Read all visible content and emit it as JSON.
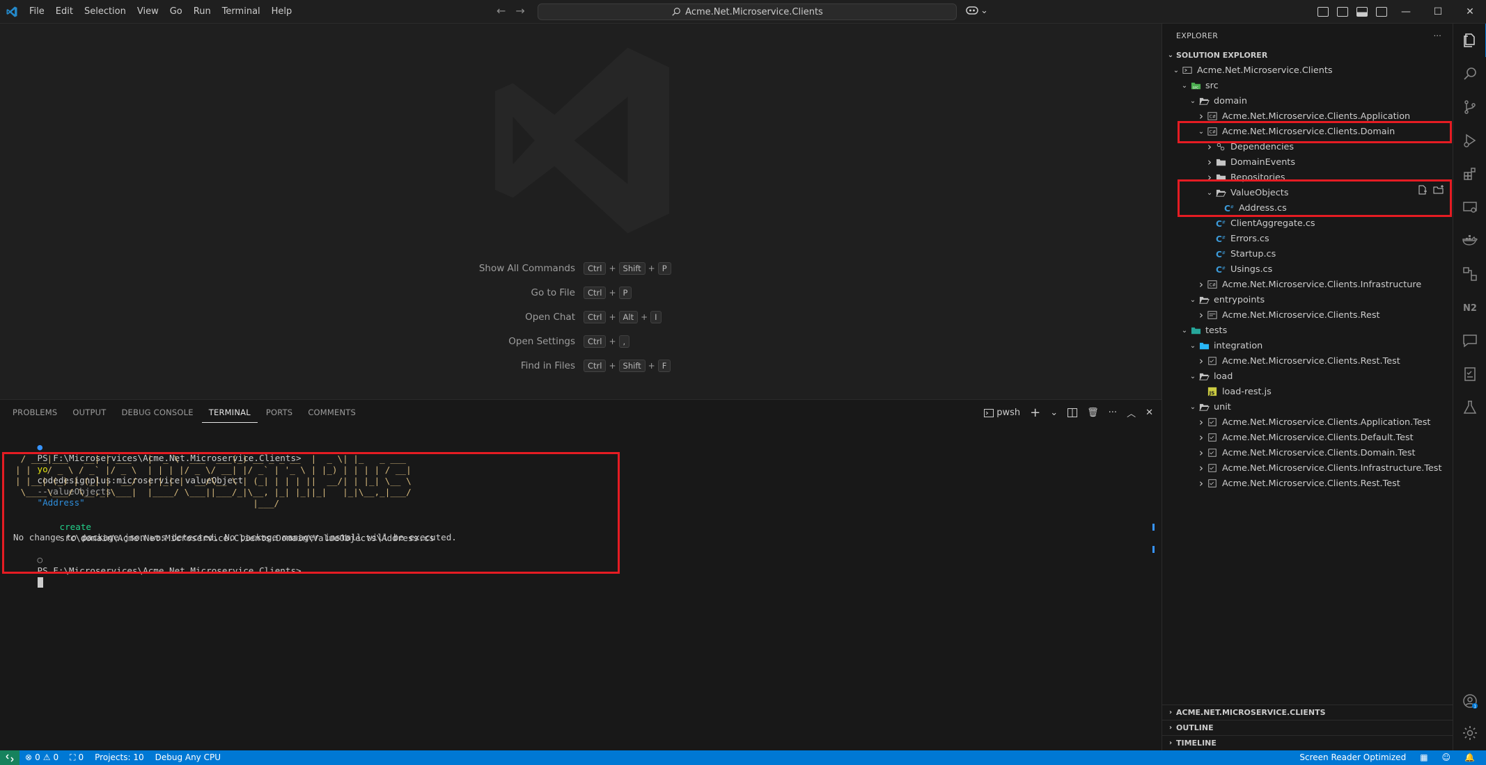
{
  "menu": [
    "File",
    "Edit",
    "Selection",
    "View",
    "Go",
    "Run",
    "Terminal",
    "Help"
  ],
  "title": {
    "search": "Acme.Net.Microservice.Clients",
    "back": "←",
    "forward": "→",
    "copilot_caret": "⌄"
  },
  "window": {
    "minimize": "—",
    "maximize": "☐",
    "close": "✕"
  },
  "shortcuts": [
    {
      "label": "Show All Commands",
      "keys": [
        "Ctrl",
        "Shift",
        "P"
      ]
    },
    {
      "label": "Go to File",
      "keys": [
        "Ctrl",
        "P"
      ]
    },
    {
      "label": "Open Chat",
      "keys": [
        "Ctrl",
        "Alt",
        "I"
      ]
    },
    {
      "label": "Open Settings",
      "keys": [
        "Ctrl",
        ","
      ]
    },
    {
      "label": "Find in Files",
      "keys": [
        "Ctrl",
        "Shift",
        "F"
      ]
    }
  ],
  "panel": {
    "tabs": [
      "PROBLEMS",
      "OUTPUT",
      "DEBUG CONSOLE",
      "TERMINAL",
      "PORTS",
      "COMMENTS"
    ],
    "active_tab": "TERMINAL",
    "shell": "pwsh"
  },
  "terminal": {
    "prompt": "PS F:\\Microservices\\Acme.Net.Microservice.Clients>",
    "cmd_yo": "yo",
    "cmd_rest": "codedesignplus:microservice valueObject",
    "cmd_flag": "--valueObjects",
    "cmd_arg": "\"Address\"",
    "ascii": [
      "  ____          _         ____            _              ____  _            ",
      " / ___|___   __| | ___   |  _ \\  ___  ___(_) __ _ _ __  |  _ \\| |_   _ ___ ",
      "| |   / _ \\ / _` |/ _ \\  | | | |/ _ \\/ __| |/ _` | '_ \\ | |_) | | | | / __|",
      "| |__| (_) | (_| |  __/  | |_| |  __/\\__ \\ | (_| | | | ||  __/| | |_| \\__ \\",
      " \\____\\___/ \\__,_|\\___|  |____/ \\___||___/_|\\__, |_| |_||_|   |_|\\__,_|___/",
      "                                             |___/                          "
    ],
    "create_word": "create",
    "create_path": "src\\domain\\Acme.Net.Microservice.Clients.Domain\\ValueObjects\\Address.cs",
    "notice": "No change to package.json was detected. No package manager install will be executed."
  },
  "explorer": {
    "header": "EXPLORER",
    "more": "···",
    "section": "SOLUTION EXPLORER",
    "tree": [
      {
        "label": "Acme.Net.Microservice.Clients",
        "depth": 0,
        "chevron": "open",
        "icon": "solution"
      },
      {
        "label": "src",
        "depth": 1,
        "chevron": "open",
        "icon": "folder-src"
      },
      {
        "label": "domain",
        "depth": 2,
        "chevron": "open",
        "icon": "folder-open"
      },
      {
        "label": "Acme.Net.Microservice.Clients.Application",
        "depth": 3,
        "chevron": "closed",
        "icon": "project"
      },
      {
        "label": "Acme.Net.Microservice.Clients.Domain",
        "depth": 3,
        "chevron": "open",
        "icon": "project"
      },
      {
        "label": "Dependencies",
        "depth": 4,
        "chevron": "closed",
        "icon": "dependencies"
      },
      {
        "label": "DomainEvents",
        "depth": 4,
        "chevron": "closed",
        "icon": "folder"
      },
      {
        "label": "Repositories",
        "depth": 4,
        "chevron": "closed",
        "icon": "folder"
      },
      {
        "label": "ValueObjects",
        "depth": 4,
        "chevron": "open",
        "icon": "folder-open"
      },
      {
        "label": "Address.cs",
        "depth": 5,
        "chevron": "none",
        "icon": "csharp"
      },
      {
        "label": "ClientAggregate.cs",
        "depth": 4,
        "chevron": "none",
        "icon": "csharp"
      },
      {
        "label": "Errors.cs",
        "depth": 4,
        "chevron": "none",
        "icon": "csharp"
      },
      {
        "label": "Startup.cs",
        "depth": 4,
        "chevron": "none",
        "icon": "csharp"
      },
      {
        "label": "Usings.cs",
        "depth": 4,
        "chevron": "none",
        "icon": "csharp"
      },
      {
        "label": "Acme.Net.Microservice.Clients.Infrastructure",
        "depth": 3,
        "chevron": "closed",
        "icon": "project"
      },
      {
        "label": "entrypoints",
        "depth": 2,
        "chevron": "open",
        "icon": "folder-open"
      },
      {
        "label": "Acme.Net.Microservice.Clients.Rest",
        "depth": 3,
        "chevron": "closed",
        "icon": "project-web"
      },
      {
        "label": "tests",
        "depth": 1,
        "chevron": "open",
        "icon": "folder-test"
      },
      {
        "label": "integration",
        "depth": 2,
        "chevron": "open",
        "icon": "folder-integration"
      },
      {
        "label": "Acme.Net.Microservice.Clients.Rest.Test",
        "depth": 3,
        "chevron": "closed",
        "icon": "project-test"
      },
      {
        "label": "load",
        "depth": 2,
        "chevron": "open",
        "icon": "folder-open"
      },
      {
        "label": "load-rest.js",
        "depth": 3,
        "chevron": "none",
        "icon": "js"
      },
      {
        "label": "unit",
        "depth": 2,
        "chevron": "open",
        "icon": "folder-open"
      },
      {
        "label": "Acme.Net.Microservice.Clients.Application.Test",
        "depth": 3,
        "chevron": "closed",
        "icon": "project-test"
      },
      {
        "label": "Acme.Net.Microservice.Clients.Default.Test",
        "depth": 3,
        "chevron": "closed",
        "icon": "project-test"
      },
      {
        "label": "Acme.Net.Microservice.Clients.Domain.Test",
        "depth": 3,
        "chevron": "closed",
        "icon": "project-test"
      },
      {
        "label": "Acme.Net.Microservice.Clients.Infrastructure.Test",
        "depth": 3,
        "chevron": "closed",
        "icon": "project-test"
      },
      {
        "label": "Acme.Net.Microservice.Clients.Rest.Test",
        "depth": 3,
        "chevron": "closed",
        "icon": "project-test"
      }
    ],
    "bottom_sections": [
      "ACME.NET.MICROSERVICE.CLIENTS",
      "OUTLINE",
      "TIMELINE"
    ]
  },
  "status": {
    "errors": "0",
    "warnings": "0",
    "ports": "0",
    "projects": "Projects: 10",
    "debug": "Debug Any CPU",
    "screen_reader": "Screen Reader Optimized",
    "accounts_badge": "1"
  },
  "colors": {
    "accent": "#0078d4",
    "highlight_box": "#e51c23",
    "folder": "#c5c5c5",
    "csharp": "#3c9ad8",
    "js": "#cbcb41"
  }
}
